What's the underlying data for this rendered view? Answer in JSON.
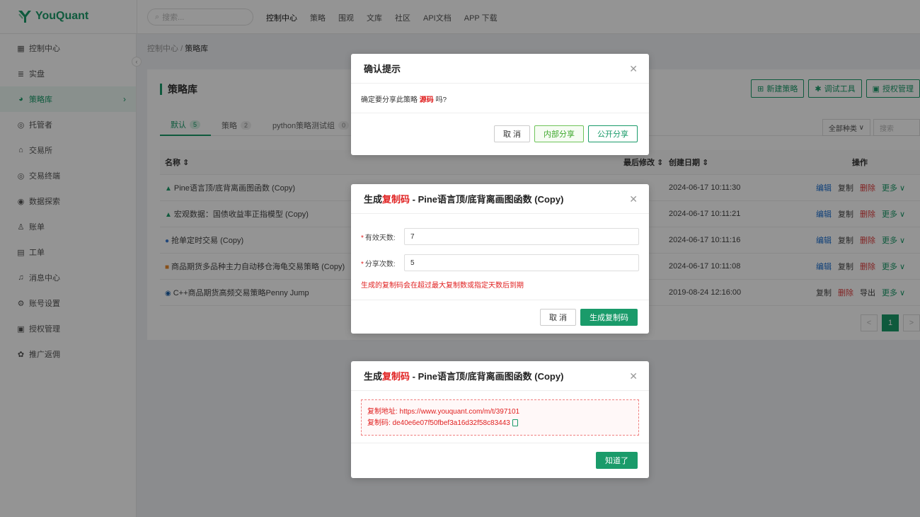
{
  "brand": {
    "name": "YouQuant",
    "color": "#1a9b6a"
  },
  "search": {
    "placeholder": "搜索..."
  },
  "topnav": [
    "控制中心",
    "策略",
    "围观",
    "文库",
    "社区",
    "API文档",
    "APP 下载"
  ],
  "sidebar": {
    "items": [
      {
        "label": "控制中心",
        "icon": "dashboard-icon",
        "glyph": "▦"
      },
      {
        "label": "实盘",
        "icon": "list-icon",
        "glyph": "≣"
      },
      {
        "label": "策略库",
        "icon": "strategy-icon",
        "glyph": "◕",
        "active": true
      },
      {
        "label": "托管者",
        "icon": "cloud-icon",
        "glyph": "◎"
      },
      {
        "label": "交易所",
        "icon": "bank-icon",
        "glyph": "⌂"
      },
      {
        "label": "交易终端",
        "icon": "terminal-icon",
        "glyph": "◎"
      },
      {
        "label": "数据探索",
        "icon": "explore-icon",
        "glyph": "◉"
      },
      {
        "label": "账单",
        "icon": "user-bill-icon",
        "glyph": "♙"
      },
      {
        "label": "工单",
        "icon": "ticket-icon",
        "glyph": "▤"
      },
      {
        "label": "消息中心",
        "icon": "bell-icon",
        "glyph": "♫"
      },
      {
        "label": "账号设置",
        "icon": "gear-icon",
        "glyph": "⚙"
      },
      {
        "label": "授权管理",
        "icon": "license-icon",
        "glyph": "▣"
      },
      {
        "label": "推广返佣",
        "icon": "gift-icon",
        "glyph": "✿"
      }
    ]
  },
  "breadcrumb": {
    "root": "控制中心",
    "sep": "/",
    "current": "策略库"
  },
  "panel": {
    "title": "策略库",
    "actions": [
      "新建策略",
      "调试工具",
      "授权管理"
    ],
    "tabs": [
      {
        "label": "默认",
        "count": "5"
      },
      {
        "label": "策略",
        "count": "2"
      },
      {
        "label": "python策略测试组",
        "count": "0"
      }
    ],
    "filter": {
      "category": "全部种类",
      "search_placeholder": "搜索"
    },
    "columns": {
      "name": "名称 ⇕",
      "modified": "最后修改 ⇕",
      "created": "创建日期 ⇕",
      "ops": "操作"
    },
    "rows": [
      {
        "icon": "pine-icon",
        "glyph": "▲",
        "color": "#1a9b6a",
        "name": "Pine语言顶/底背离画图函数 (Copy)",
        "created": "2024-06-17 10:11:30",
        "ops": [
          "编辑",
          "复制",
          "删除",
          "更多 ∨"
        ]
      },
      {
        "icon": "pine-icon",
        "glyph": "▲",
        "color": "#1a9b6a",
        "name": "宏观数据：国债收益率正指模型 (Copy)",
        "created": "2024-06-17 10:11:21",
        "ops": [
          "编辑",
          "复制",
          "删除",
          "更多 ∨"
        ]
      },
      {
        "icon": "python-icon",
        "glyph": "●",
        "color": "#3a7bd5",
        "name": "抢单定时交易 (Copy)",
        "created": "2024-06-17 10:11:16",
        "ops": [
          "编辑",
          "复制",
          "删除",
          "更多 ∨"
        ]
      },
      {
        "icon": "javascript-icon",
        "glyph": "■",
        "color": "#e8892c",
        "name": "商品期货多品种主力自动移仓海龟交易策略 (Copy)",
        "created": "2024-06-17 10:11:08",
        "ops": [
          "编辑",
          "复制",
          "删除",
          "更多 ∨"
        ]
      },
      {
        "icon": "cpp-icon",
        "glyph": "◉",
        "color": "#1a5fa8",
        "name": "C++商品期货高频交易策略Penny Jump",
        "created": "2019-08-24 12:16:00",
        "ops": [
          "复制",
          "删除",
          "导出",
          "更多 ∨"
        ]
      }
    ],
    "pager": {
      "prev": "<",
      "current": "1",
      "next": ">"
    }
  },
  "modal_confirm": {
    "title": "确认提示",
    "body_prefix": "确定要分享此策略",
    "body_highlight": "源码",
    "body_suffix": "吗?",
    "cancel": "取 消",
    "internal": "内部分享",
    "public": "公开分享"
  },
  "modal_generate": {
    "title_prefix": "生成",
    "title_red": "复制码",
    "title_suffix": " - Pine语言顶/底背离画图函数 (Copy)",
    "days_label": "有效天数:",
    "days_value": "7",
    "times_label": "分享次数:",
    "times_value": "5",
    "warning": "生成的复制码会在超过最大复制数或指定天数后到期",
    "cancel": "取 消",
    "submit": "生成复制码"
  },
  "modal_result": {
    "title_prefix": "生成",
    "title_red": "复制码",
    "title_suffix": " - Pine语言顶/底背离画图函数 (Copy)",
    "address_line": "复制地址: https://www.youquant.com/m/t/397101",
    "code_line": "复制码: de40e6e07f50fbef3a16d32f58c83443",
    "ok": "知道了"
  }
}
